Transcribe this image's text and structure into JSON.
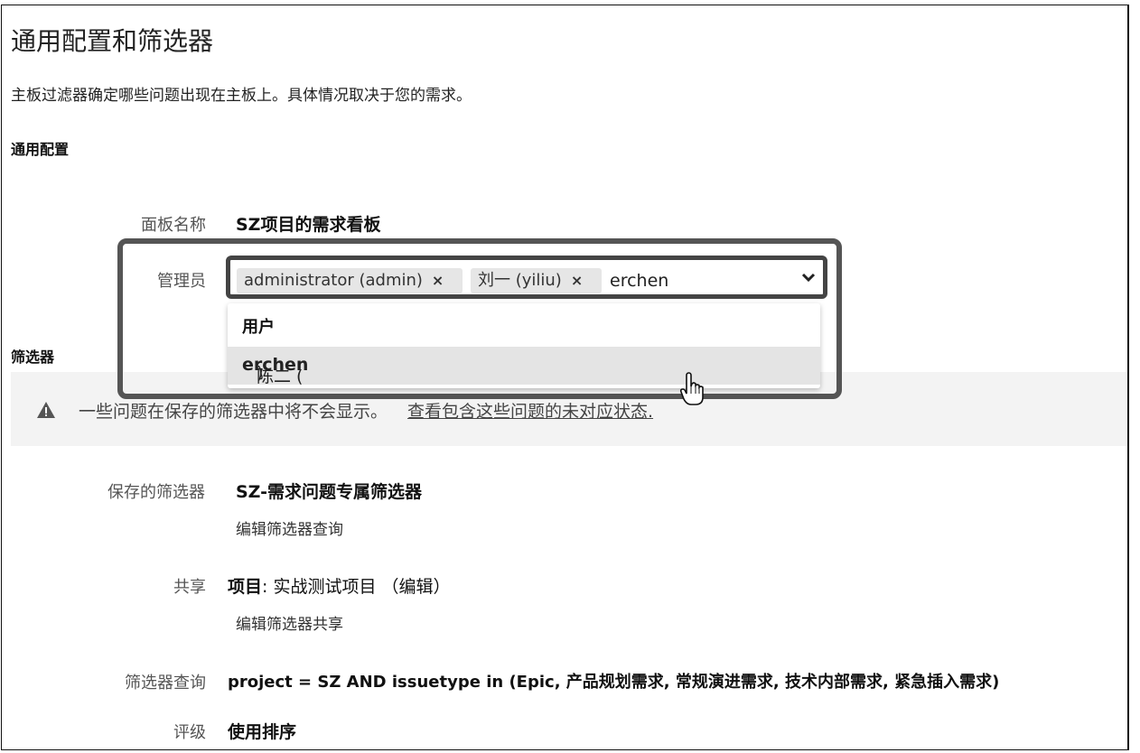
{
  "page": {
    "title": "通用配置和筛选器",
    "description": "主板过滤器确定哪些问题出现在主板上。具体情况取决于您的需求。"
  },
  "general": {
    "heading": "通用配置",
    "board_name_label": "面板名称",
    "board_name_value": "SZ项目的需求看板",
    "admin_label": "管理员",
    "admins": [
      {
        "label": "administrator (admin)",
        "remove": "×"
      },
      {
        "label": "刘一 (yiliu)",
        "remove": "×"
      }
    ],
    "admin_typed": "erchen",
    "dropdown": {
      "group": "用户",
      "option_prefix": "陈二 (",
      "option_match": "erchen",
      "option_suffix": ")"
    }
  },
  "filter": {
    "heading": "筛选器",
    "warning_text": "一些问题在保存的筛选器中将不会显示。",
    "warning_link": "查看包含这些问题的未对应状态.",
    "saved_filter_label": "保存的筛选器",
    "saved_filter_value": "SZ-需求问题专属筛选器",
    "edit_filter_query": "编辑筛选器查询",
    "share_label": "共享",
    "share_value_bold": "项目",
    "share_value_rest": ": 实战测试项目 （编辑）",
    "edit_filter_share": "编辑筛选器共享",
    "query_label": "筛选器查询",
    "query_value": "project = SZ AND issuetype in (Epic, 产品规划需求, 常规演进需求, 技术内部需求, 紧急插入需求)",
    "rank_label": "评级",
    "rank_value": "使用排序"
  },
  "colors": {
    "highlight_border": "#555555",
    "warning_bg": "#f3f3f3",
    "chip_bg": "#e6e6e6",
    "option_hover": "#e4e4e4"
  },
  "icons": [
    "warning-icon",
    "chevron-down-icon",
    "hand-cursor-icon",
    "remove-icon"
  ]
}
